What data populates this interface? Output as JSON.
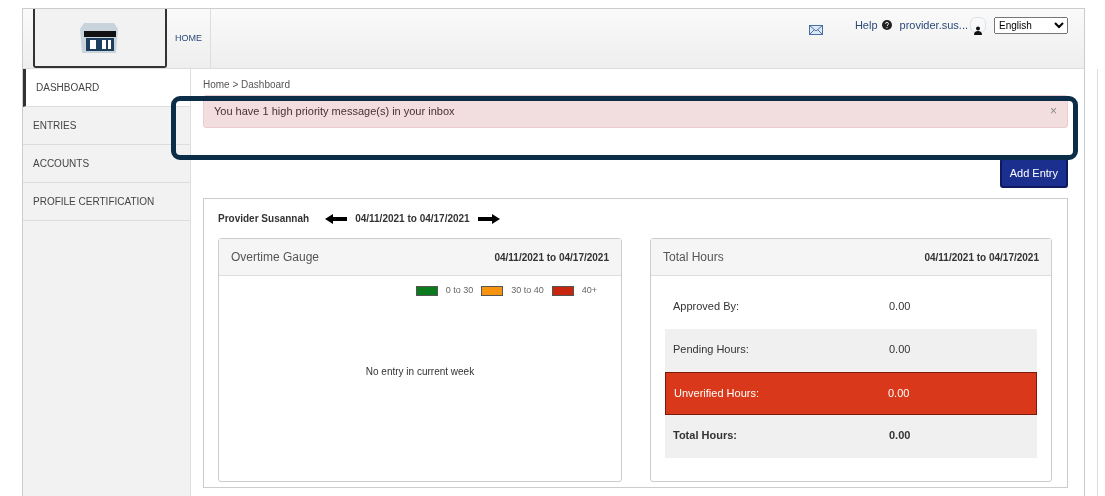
{
  "nav": {
    "home": "HOME",
    "help": "Help",
    "user": "provider.sus...",
    "language": "English"
  },
  "sidebar": {
    "items": [
      {
        "label": "DASHBOARD",
        "selected": true
      },
      {
        "label": "ENTRIES",
        "selected": false
      },
      {
        "label": "ACCOUNTS",
        "selected": false
      },
      {
        "label": "PROFILE CERTIFICATION",
        "selected": false
      }
    ]
  },
  "breadcrumb": "Home > Dashboard",
  "alert": {
    "message": "You have 1 high priority message(s) in your inbox",
    "close": "×"
  },
  "add_entry_button": "Add Entry",
  "provider": {
    "name": "Provider Susannah",
    "range": "04/11/2021 to 04/17/2021"
  },
  "overtime_gauge": {
    "title": "Overtime Gauge",
    "range": "04/11/2021 to 04/17/2021",
    "legend": [
      {
        "label": "0 to 30",
        "color": "#0b7a1c"
      },
      {
        "label": "30 to 40",
        "color": "#f7930f"
      },
      {
        "label": "40+",
        "color": "#c8250e"
      }
    ],
    "empty": "No entry in current week"
  },
  "total_hours": {
    "title": "Total Hours",
    "range": "04/11/2021 to 04/17/2021",
    "rows": [
      {
        "kind": "plain",
        "label": "Approved By:",
        "value": "0.00"
      },
      {
        "kind": "shaded",
        "label": "Pending Hours:",
        "value": "0.00"
      },
      {
        "kind": "alert",
        "label": "Unverified Hours:",
        "value": "0.00"
      },
      {
        "kind": "total",
        "label": "Total Hours:",
        "value": "0.00"
      }
    ]
  }
}
